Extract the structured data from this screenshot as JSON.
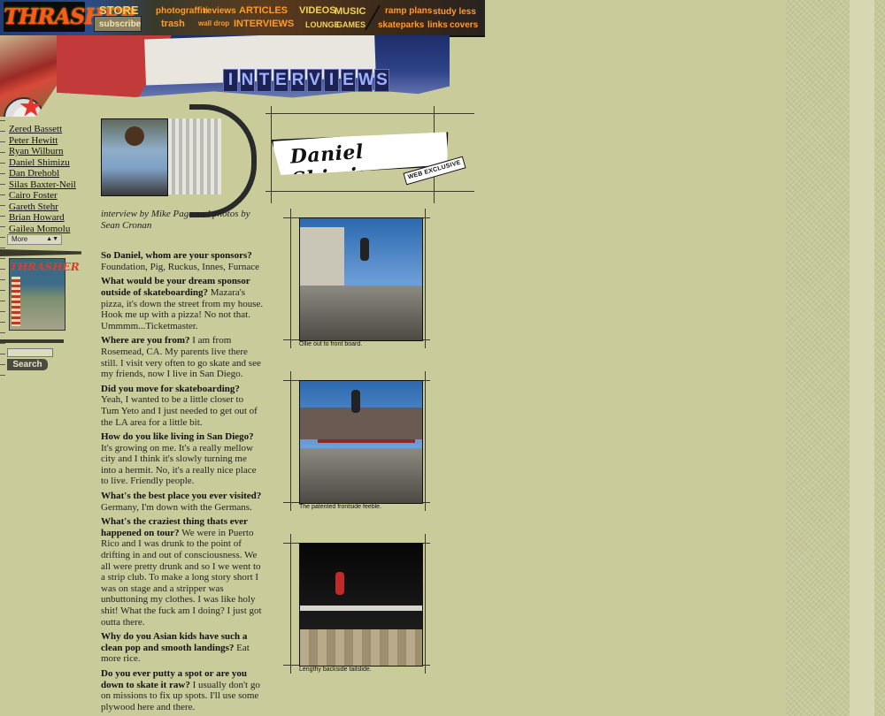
{
  "brand": {
    "logo_text": "THRASHER"
  },
  "nav": {
    "store": "STORE",
    "subscribe": "subscribe",
    "photograffiti": "photograffiti",
    "reviews": "reviews",
    "articles": "ARTICLES",
    "trash": "trash",
    "wall_drop": "wall drop",
    "interviews": "INTERVIEWS",
    "videos": "VIDEOS",
    "music": "MUSIC",
    "lounge": "LOUNGE",
    "games": "GAMES",
    "ramp_plans": "ramp plans",
    "study_less": "study less",
    "skateparks": "skateparks",
    "links": "links",
    "covers": "covers"
  },
  "banner": {
    "letters": [
      "I",
      "N",
      "T",
      "E",
      "R",
      "V",
      "I",
      "E",
      "W",
      "S"
    ]
  },
  "sidebar": {
    "links": [
      "Zered Bassett",
      "Peter Hewitt",
      "Ryan Wilburn",
      "Daniel Shimizu",
      "Dan Drehobl",
      "Silas Baxter-Neil",
      "Cairo Foster",
      "Gareth Stehr",
      "Brian Howard",
      "Gailea Momolu"
    ],
    "more_select": "More",
    "magazine_title": "THRASHER",
    "search_value": "",
    "search_button": "Search"
  },
  "interview": {
    "name": "Daniel Shimizu",
    "badge": "WEB EXCLUSIVE",
    "credit": "interview by Mike Page and photos by Sean Cronan",
    "qa": [
      {
        "q": "So Daniel, whom are your sponsors?",
        "a": "Foundation, Pig, Ruckus, Innes, Furnace"
      },
      {
        "q": "What would be your dream sponsor outside of skateboarding?",
        "a": "Mazara's pizza, it's down the street from my house. Hook me up with a pizza! No not that. Ummmm...Ticketmaster."
      },
      {
        "q": "Where are you from?",
        "a": "I am from Rosemead, CA. My parents live there still. I visit very often to go skate and see my friends, now I live in San Diego."
      },
      {
        "q": "Did you move for skateboarding?",
        "a": "Yeah, I wanted to be a little closer to Tum Yeto and I just needed to get out of the LA area for a little bit."
      },
      {
        "q": "How do you like living in San Diego?",
        "a": "It's growing on me. It's a really mellow city and I think it's slowly turning me into a hermit. No, it's a really nice place to live. Friendly people."
      },
      {
        "q": "What's the best place you ever visited?",
        "a": "Germany, I'm down with the Germans."
      },
      {
        "q": "What's the craziest thing thats ever happened on tour?",
        "a": "We were in Puerto Rico and I was drunk to the point of drifting in and out of consciousness. We all were pretty drunk and so I we went to a strip club. To make a long story short I was on stage and a stripper was unbuttoning my clothes. I was like holy shit! What the fuck am I doing? I just got outta there."
      },
      {
        "q": "Why do you Asian kids have such a clean pop and smooth landings?",
        "a": "Eat more rice."
      },
      {
        "q": "Do you ever putty a spot or are you down to skate it raw?",
        "a": "I usually don't go on missions to fix up spots. I'll use some plywood here and there."
      }
    ]
  },
  "photos": [
    {
      "caption": "Ollie out to front board."
    },
    {
      "caption": "The patented frontside feeble."
    },
    {
      "caption": "Lengthy backside tailslide."
    }
  ],
  "colors": {
    "page_bg": "#c9cb9a",
    "nav_text": "#f4d35e",
    "logo": "#ff5a1a"
  }
}
